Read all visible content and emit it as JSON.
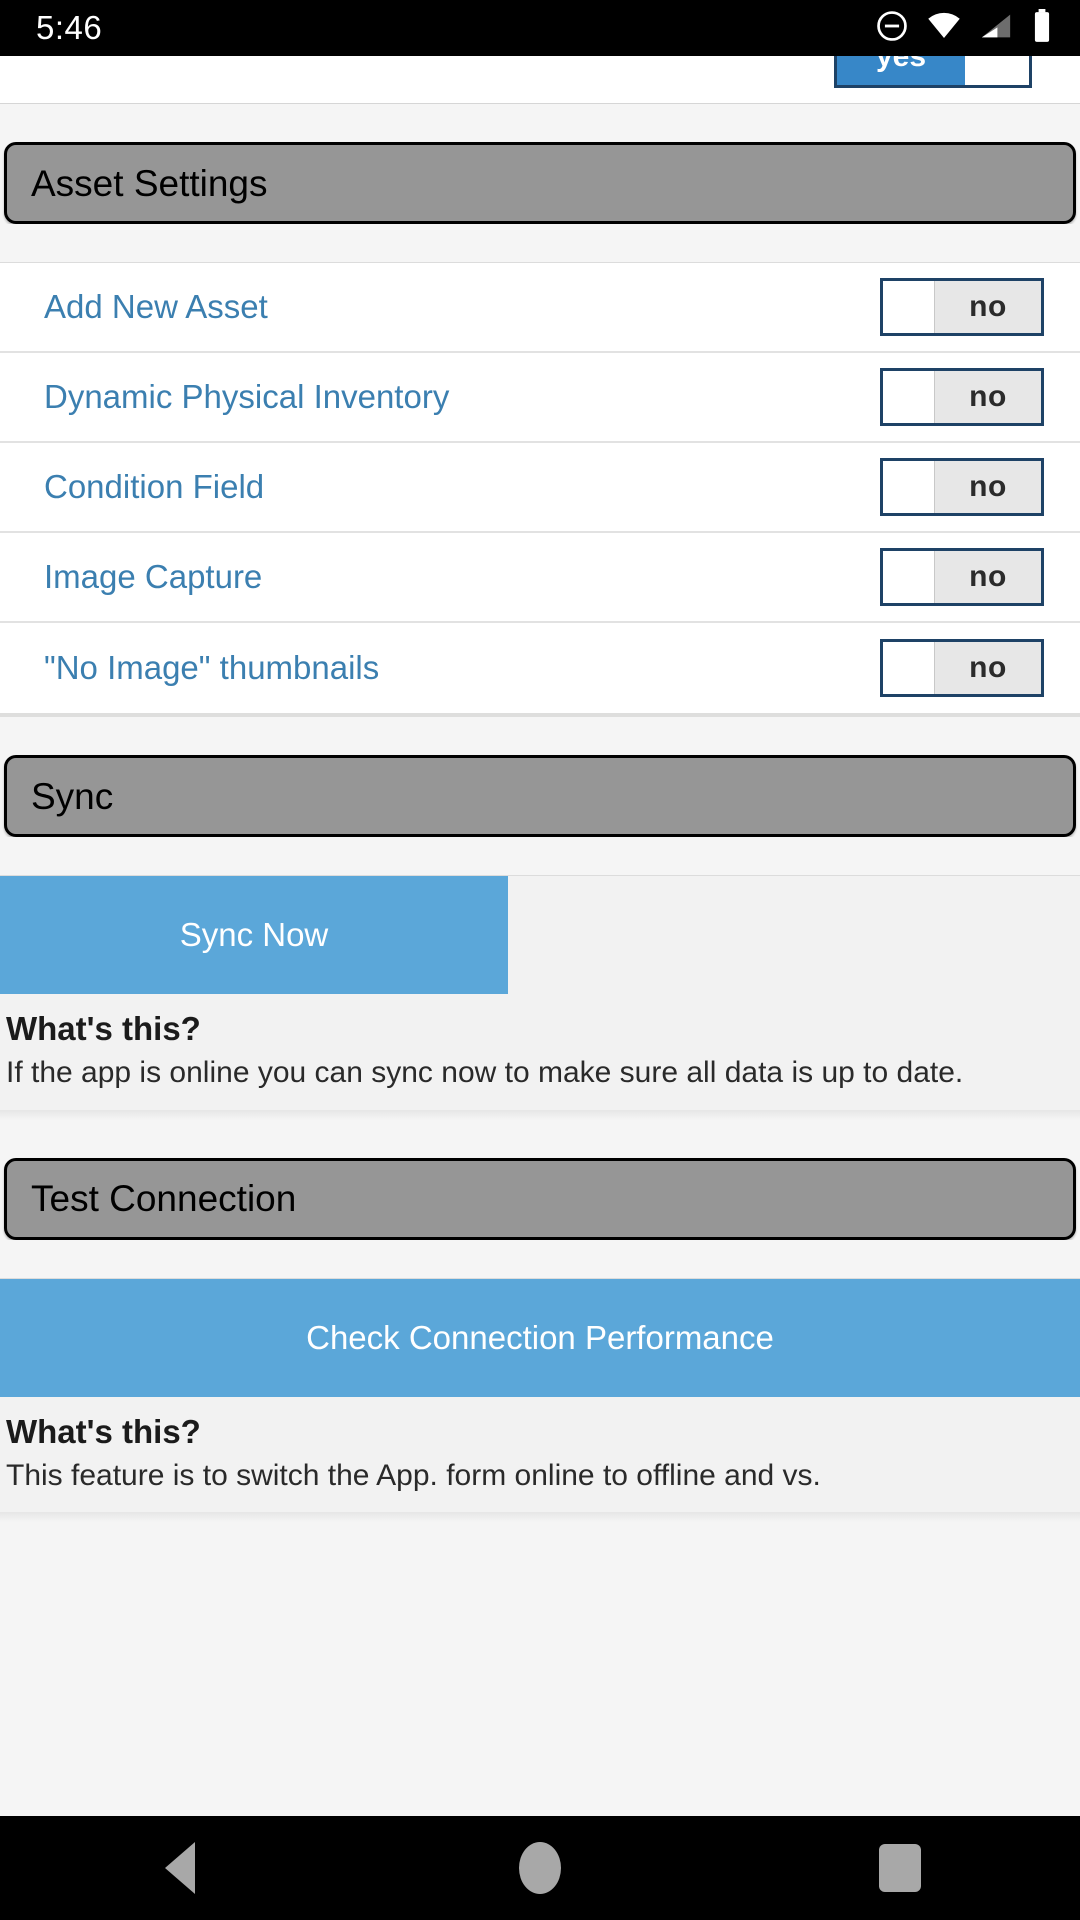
{
  "status_bar": {
    "time": "5:46",
    "icons": [
      "do-not-disturb-icon",
      "wifi-icon",
      "cellular-signal-icon",
      "battery-icon"
    ]
  },
  "clipped_top_row": {
    "toggle_value": "yes"
  },
  "sections": {
    "asset_settings": {
      "title": "Asset Settings",
      "rows": [
        {
          "label": "Add New Asset",
          "value": "no"
        },
        {
          "label": "Dynamic Physical Inventory",
          "value": "no"
        },
        {
          "label": "Condition Field",
          "value": "no"
        },
        {
          "label": "Image Capture",
          "value": "no"
        },
        {
          "label": "\"No Image\" thumbnails",
          "value": "no"
        }
      ]
    },
    "sync": {
      "title": "Sync",
      "button_label": "Sync Now",
      "help_title": "What's this?",
      "help_text": "If the app is online you can sync now to make sure all data is up to date."
    },
    "test_connection": {
      "title": "Test Connection",
      "button_label": "Check Connection Performance",
      "help_title": "What's this?",
      "help_text": "This feature is to switch the App. form online to offline and vs."
    }
  },
  "nav_bar": {
    "back": "back-button",
    "home": "home-button",
    "recents": "recents-button"
  },
  "colors": {
    "accent_blue": "#5ba7d9",
    "link_blue": "#3b7fb0",
    "header_gray": "#969696",
    "toggle_border": "#1e4266"
  }
}
